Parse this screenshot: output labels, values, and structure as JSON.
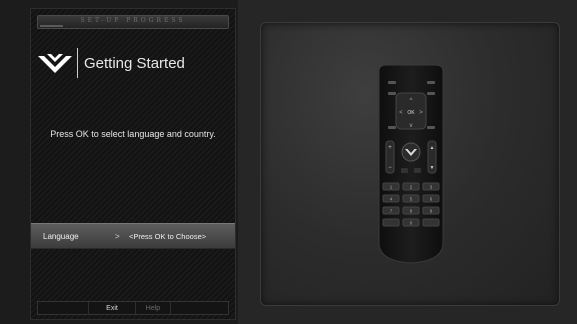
{
  "setup": {
    "progress_label": "SET-UP PROGRESS",
    "progress_fraction": 0.12,
    "title": "Getting Started",
    "instruction": "Press OK to select language and country."
  },
  "menu": {
    "language_label": "Language",
    "arrow": ">",
    "language_value": "<Press OK to Choose>"
  },
  "footer": {
    "exit_label": "Exit",
    "help_label": "Help"
  },
  "remote": {
    "ok_label": "OK",
    "keypad": [
      "1",
      "2",
      "3",
      "4",
      "5",
      "6",
      "7",
      "8",
      "9",
      "",
      "0",
      ""
    ]
  },
  "colors": {
    "background": "#1c1c1c",
    "panel_text": "#e6e6e6",
    "highlight_row": "#5d5d5d",
    "remote_body": "#161616"
  }
}
